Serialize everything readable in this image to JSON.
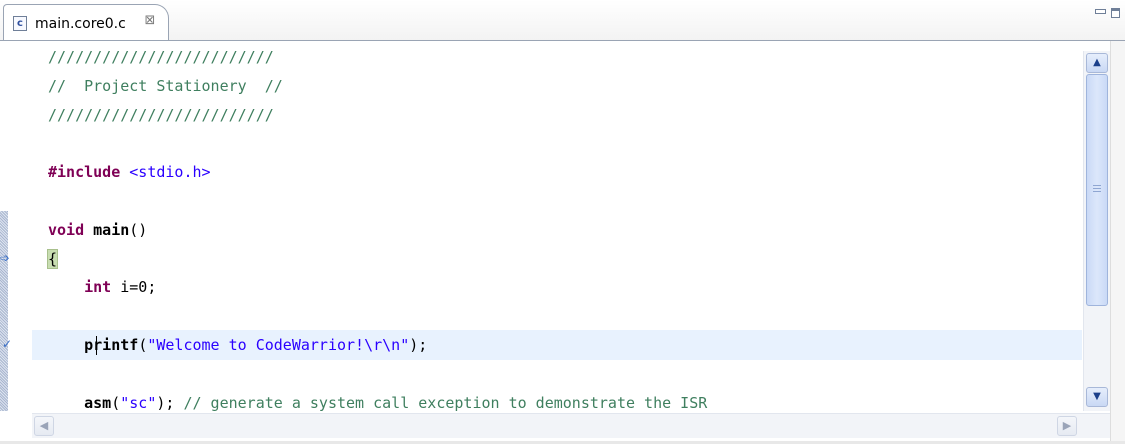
{
  "tab": {
    "icon_label": "c",
    "title": "main.core0.c",
    "close_symbol": "⊠"
  },
  "window_controls": {
    "minimize": "minimize-icon",
    "maximize": "maximize-icon"
  },
  "code_lines": [
    [
      {
        "t": "/////////////////////////",
        "c": "comment"
      }
    ],
    [
      {
        "t": "//  Project Stationery  //",
        "c": "comment"
      }
    ],
    [
      {
        "t": "/////////////////////////",
        "c": "comment"
      }
    ],
    [],
    [
      {
        "t": "#include",
        "c": "directive"
      },
      {
        "t": " ",
        "c": "plain"
      },
      {
        "t": "<stdio.h>",
        "c": "header"
      }
    ],
    [],
    [
      {
        "t": "void",
        "c": "keyword"
      },
      {
        "t": " ",
        "c": "plain"
      },
      {
        "t": "main",
        "c": "bold"
      },
      {
        "t": "()",
        "c": "plain"
      }
    ],
    [
      {
        "t": "{",
        "c": "brace"
      }
    ],
    [
      {
        "t": "    ",
        "c": "plain"
      },
      {
        "t": "int",
        "c": "keyword"
      },
      {
        "t": " i=0;",
        "c": "plain"
      }
    ],
    [],
    [
      {
        "t": "    ",
        "c": "plain"
      },
      {
        "t": "printf",
        "c": "bold"
      },
      {
        "t": "(",
        "c": "plain"
      },
      {
        "t": "\"Welcome to CodeWarrior!\\r\\n\"",
        "c": "string"
      },
      {
        "t": ");",
        "c": "plain"
      }
    ],
    [],
    [
      {
        "t": "    ",
        "c": "plain"
      },
      {
        "t": "asm",
        "c": "bold"
      },
      {
        "t": "(",
        "c": "plain"
      },
      {
        "t": "\"sc\"",
        "c": "string"
      },
      {
        "t": "); ",
        "c": "plain"
      },
      {
        "t": "// generate a system call exception to demonstrate the ISR",
        "c": "comment"
      }
    ]
  ],
  "editor": {
    "current_line_index": 10
  },
  "gutter_markers": [
    {
      "line_index": 7,
      "icon": "arrow-marker-icon",
      "glyph": "➩"
    },
    {
      "line_index": 10,
      "icon": "checkmark-breakpoint-icon",
      "glyph": "✓"
    }
  ],
  "colors": {
    "comment": "#3f7f5f",
    "keyword": "#7f0055",
    "string": "#2a00ff",
    "current_line": "#e8f2fe",
    "brace_match": "#c8ddb1"
  }
}
